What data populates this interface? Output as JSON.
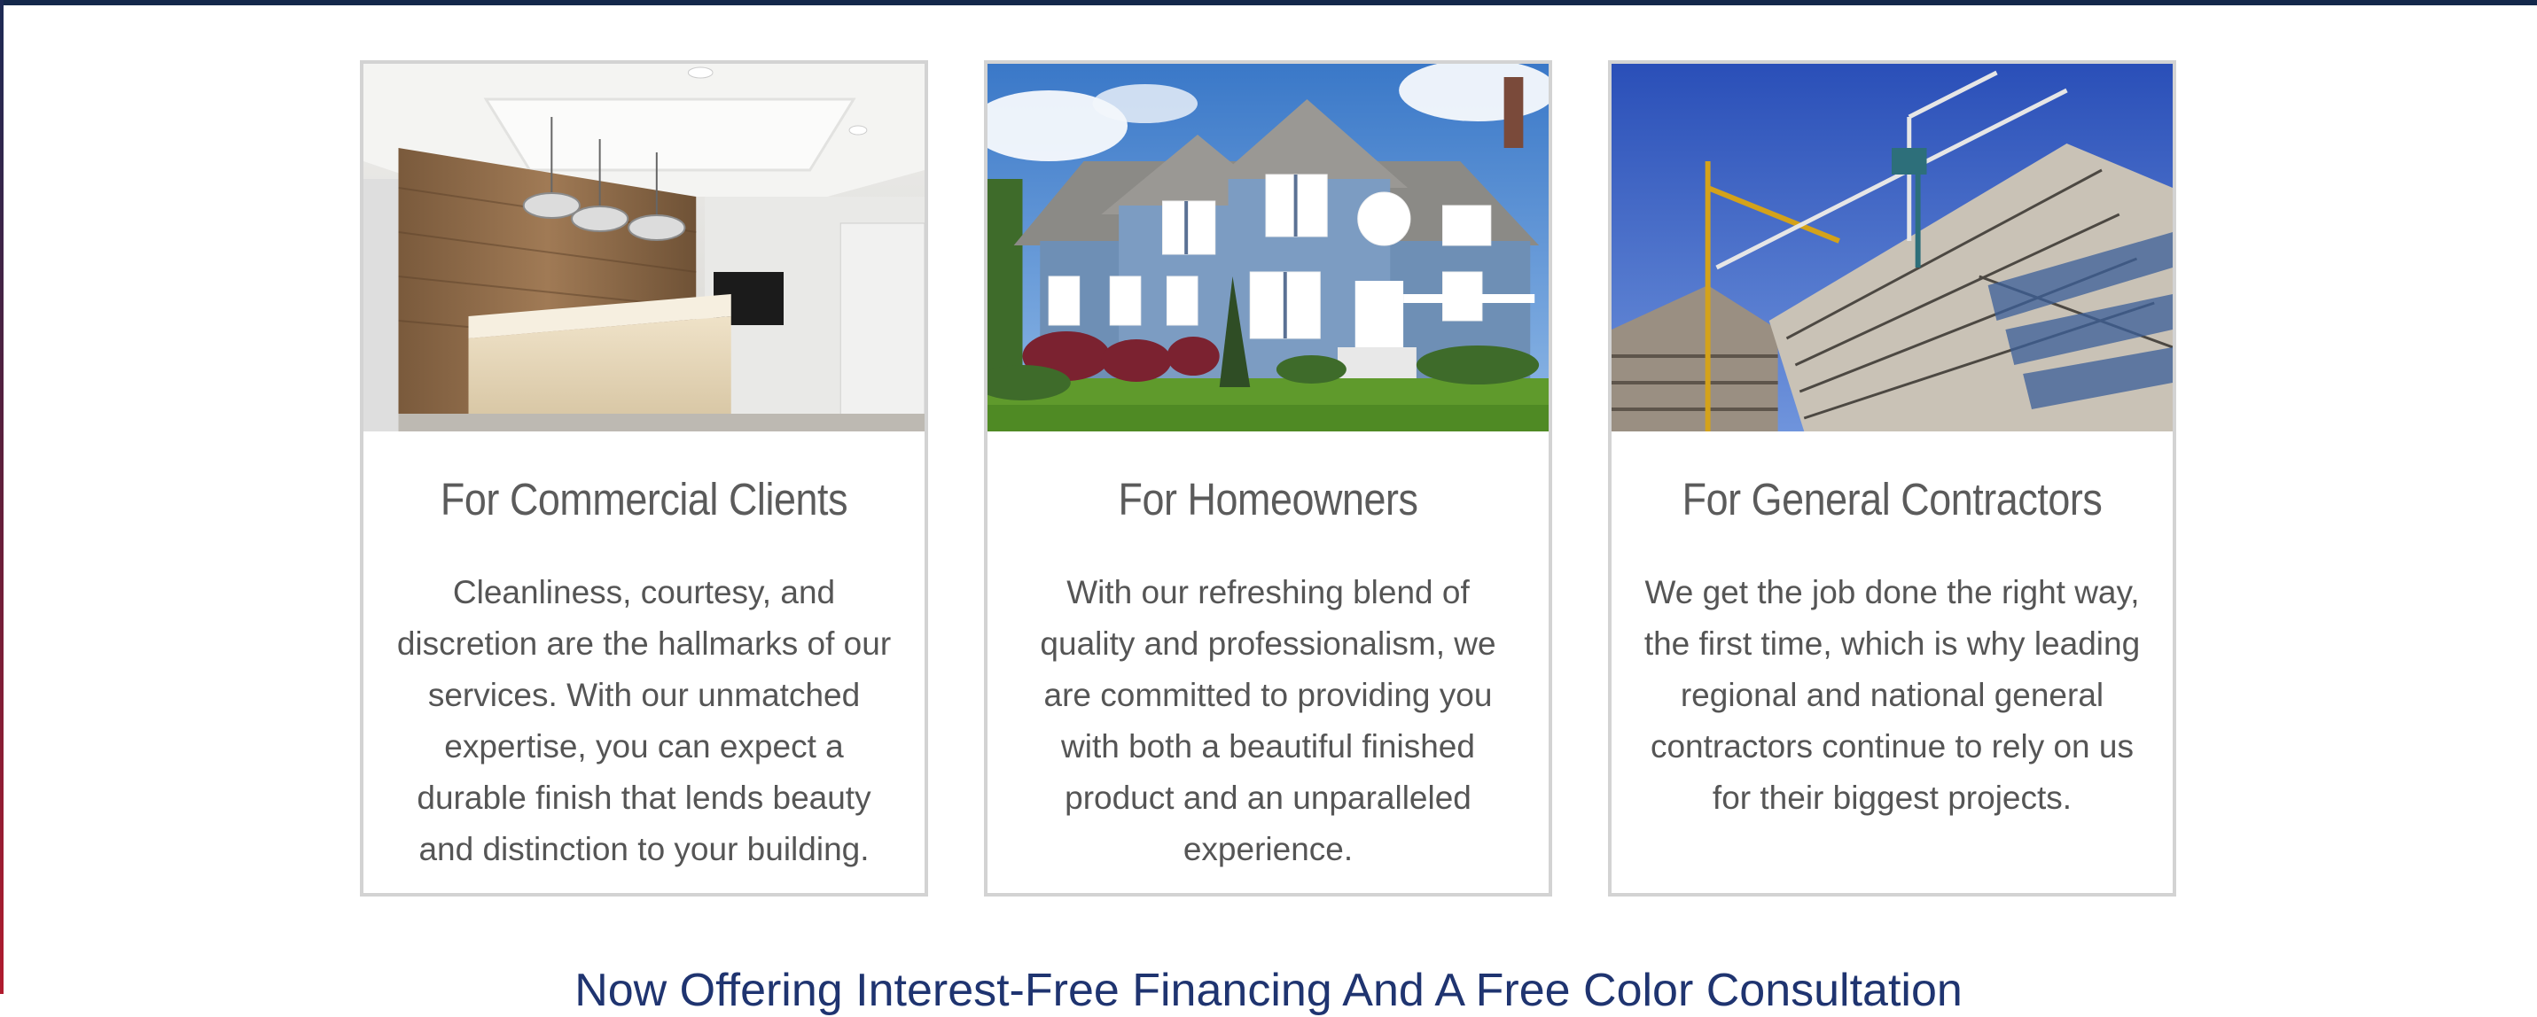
{
  "cards": [
    {
      "title": "For Commercial Clients",
      "text": "Cleanliness, courtesy, and discretion are the hallmarks of our services. With our unmatched expertise, you can expect a durable finish that lends beauty and distinction to your building.",
      "image": "office-lobby-photo"
    },
    {
      "title": "For Homeowners",
      "text": "With our refreshing blend of quality and professionalism, we are committed to providing you with both a beautiful finished product and an unparalleled experience.",
      "image": "house-photo"
    },
    {
      "title": "For General Contractors",
      "text": "We get the job done the right way, the first time, which is why leading regional and national general contractors continue to rely on us for their biggest projects.",
      "image": "construction-site-photo"
    }
  ],
  "footer_heading": "Now Offering Interest-Free Financing And A Free Color Consultation",
  "colors": {
    "top_bar": "#14284b",
    "card_border": "#d3d3d3",
    "title_text": "#5b5b5b",
    "body_text": "#555555",
    "heading_blue": "#1f3470"
  }
}
